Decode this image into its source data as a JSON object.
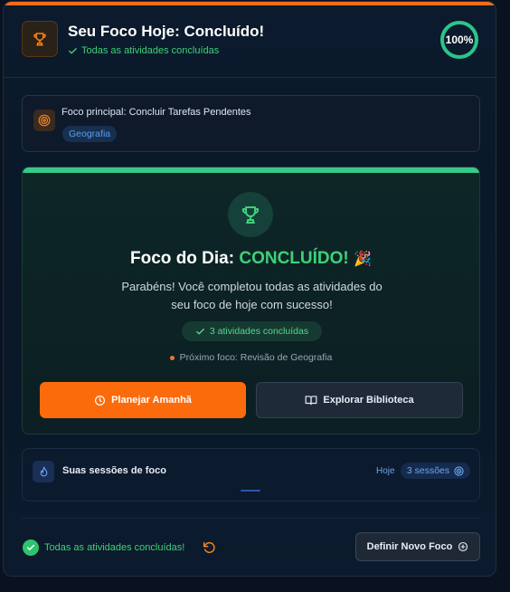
{
  "header": {
    "title": "Seu Foco Hoje: Concluído!",
    "subtitle": "Todas as atividades concluídas",
    "progress_text": "100%",
    "progress_value": 1.0
  },
  "focus": {
    "label": "Foco principal: Concluir Tarefas Pendentes",
    "tag": "Geografia"
  },
  "completion": {
    "title_prefix": "Foco do Dia: ",
    "title_status": "CONCLUÍDO!",
    "title_emoji": "🎉",
    "message": "Parabéns! Você completou todas as atividades do seu foco de hoje com sucesso!",
    "activities_pill": "3 atividades concluídas",
    "next_focus": "Próximo foco: Revisão de Geografia",
    "plan_button": "Planejar Amanhã",
    "explore_button": "Explorar Biblioteca"
  },
  "sessions": {
    "label": "Suas sessões de foco",
    "today_label": "Hoje",
    "count_label": "3 sessões"
  },
  "footer": {
    "status_text": "Todas as atividades concluídas!",
    "define_button": "Definir Novo Foco"
  },
  "colors": {
    "accent_orange": "#fb6b0c",
    "success_green": "#3ed17a",
    "info_blue": "#6ea4f0",
    "background": "#0a1220"
  },
  "icons": {
    "header": "trophy-icon",
    "focus": "target-icon",
    "completion": "trophy-icon",
    "plan": "clock-icon",
    "explore": "book-icon",
    "sessions": "flame-icon",
    "sessions_count": "target-icon",
    "footer_status": "check-circle-icon",
    "undo": "undo-icon",
    "define": "plus-circle-icon"
  }
}
